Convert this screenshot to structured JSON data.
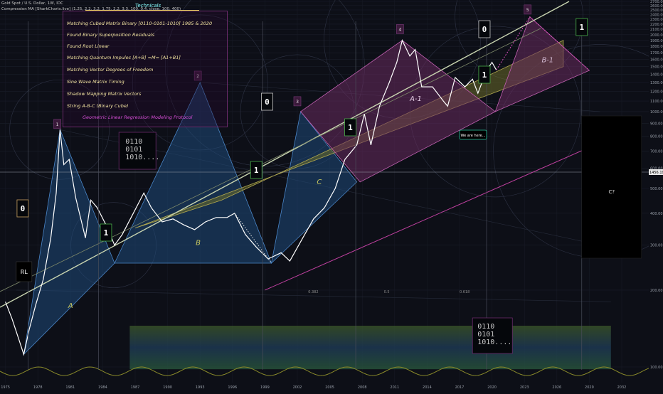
{
  "header": {
    "symbol_line": "Gold Spot / U.S. Dollar, 1W, IDC",
    "indicator_line": "Compression MA [SharkCharts.live] (1.25, 2.2, 3.2, 1.75, 2.2, 3.3, 100, 0.4, close, 100, 400)"
  },
  "technicals": {
    "title": "Technicals",
    "items": [
      "Matching Cubed Matrix Binary [0110-0101-1010]  1985 & 2020",
      "Found Binary Superposition Residuals",
      " Found Root Linear",
      "Matching Quantum Impules [A+B] =M= [A1+B1]",
      "Matching Vector Degrees of Freedom",
      "Sine Wave Matrix Timing",
      "Shadow Mapping Matrix Vectors",
      " String A-B-C  (Binary Cube)",
      "Geometric Linear Regression Modeling Protocol"
    ]
  },
  "annotations": {
    "rl": "RL",
    "we_are_here": "We are here...",
    "c_question": "C?",
    "binary_block": [
      "0110",
      "0101",
      "1010...."
    ],
    "binary_block_bottom": [
      "0110",
      "0101",
      "1010...."
    ],
    "binary_markers": [
      "0",
      "1",
      "1",
      "0",
      "1",
      "1",
      "1",
      "0",
      "1",
      "1"
    ],
    "wave_labels": [
      "A",
      "B",
      "C",
      "A-1",
      "B-1"
    ],
    "pivot_numbers": [
      "1",
      "2",
      "3",
      "4",
      "5"
    ],
    "fib_labels": [
      "0.382",
      "0.5",
      "0.618"
    ]
  },
  "price_label": "1456.19",
  "colors": {
    "background": "#0d0f17",
    "price": "#ffffff",
    "blue_fill": "#1f4a7a",
    "olive_fill": "#6b6b2a",
    "magenta_fill": "#6a2c5e",
    "trend_line": "#c8d4b0",
    "sine": "#8a8a2a"
  },
  "chart_data": {
    "type": "line",
    "title": "",
    "xlabel": "",
    "ylabel": "",
    "y_scale": "log",
    "ylim": [
      100,
      2700
    ],
    "xlim": [
      1974.5,
      2034.5
    ],
    "x_ticks": [
      1975,
      1978,
      1981,
      1984,
      1987,
      1990,
      1993,
      1996,
      1999,
      2002,
      2005,
      2008,
      2011,
      2014,
      2017,
      2020,
      2023,
      2026,
      2029,
      2032
    ],
    "y_ticks": [
      100,
      200,
      300,
      400,
      500,
      600,
      700,
      800,
      900,
      1000,
      1100,
      1200,
      1300,
      1400,
      1500,
      1600,
      1700,
      1800,
      1900,
      2000,
      2100,
      2200,
      2300,
      2400,
      2500,
      2600,
      2700
    ],
    "series": [
      {
        "values": [
          [
            1975.0,
            180
          ],
          [
            1975.6,
            155
          ],
          [
            1976.2,
            130
          ],
          [
            1976.7,
            112
          ],
          [
            1977.2,
            140
          ],
          [
            1977.8,
            175
          ],
          [
            1978.5,
            220
          ],
          [
            1979.2,
            320
          ],
          [
            1979.7,
            480
          ],
          [
            1980.05,
            850
          ],
          [
            1980.4,
            620
          ],
          [
            1980.9,
            650
          ],
          [
            1981.5,
            460
          ],
          [
            1982.4,
            320
          ],
          [
            1982.9,
            450
          ],
          [
            1983.5,
            420
          ],
          [
            1984.3,
            360
          ],
          [
            1985.1,
            300
          ],
          [
            1985.8,
            330
          ],
          [
            1986.7,
            390
          ],
          [
            1987.8,
            480
          ],
          [
            1988.5,
            420
          ],
          [
            1989.5,
            370
          ],
          [
            1990.5,
            380
          ],
          [
            1991.5,
            360
          ],
          [
            1992.5,
            345
          ],
          [
            1993.5,
            370
          ],
          [
            1994.5,
            385
          ],
          [
            1995.5,
            385
          ],
          [
            1996.2,
            400
          ],
          [
            1997.2,
            330
          ],
          [
            1998.2,
            295
          ],
          [
            1999.3,
            265
          ],
          [
            2000.5,
            280
          ],
          [
            2001.3,
            260
          ],
          [
            2002.5,
            320
          ],
          [
            2003.5,
            380
          ],
          [
            2004.5,
            420
          ],
          [
            2005.5,
            500
          ],
          [
            2006.4,
            650
          ],
          [
            2007.5,
            740
          ],
          [
            2008.2,
            980
          ],
          [
            2008.8,
            740
          ],
          [
            2009.6,
            1050
          ],
          [
            2010.5,
            1300
          ],
          [
            2011.2,
            1560
          ],
          [
            2011.7,
            1900
          ],
          [
            2012.4,
            1650
          ],
          [
            2012.9,
            1750
          ],
          [
            2013.5,
            1250
          ],
          [
            2014.5,
            1250
          ],
          [
            2015.5,
            1100
          ],
          [
            2015.9,
            1050
          ],
          [
            2016.6,
            1360
          ],
          [
            2017.5,
            1250
          ],
          [
            2018.2,
            1340
          ],
          [
            2018.7,
            1180
          ],
          [
            2019.5,
            1450
          ],
          [
            2020.0,
            1560
          ],
          [
            2020.4,
            1456
          ]
        ]
      }
    ]
  }
}
